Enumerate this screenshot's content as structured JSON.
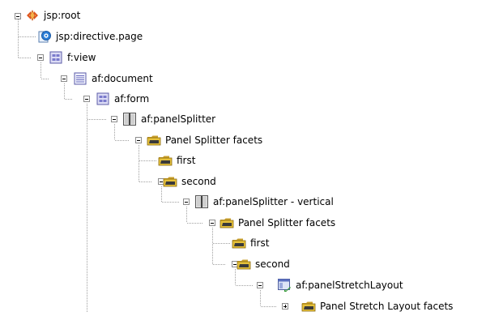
{
  "tree": {
    "nodes": [
      {
        "id": "jsp-root",
        "label": "jsp:root",
        "icon": "jsp-root-icon",
        "expanded": true
      },
      {
        "id": "jsp-directive-page",
        "label": "jsp:directive.page",
        "icon": "directive-icon"
      },
      {
        "id": "f-view",
        "label": "f:view",
        "icon": "view-icon",
        "expanded": true
      },
      {
        "id": "af-document",
        "label": "af:document",
        "icon": "document-icon",
        "expanded": true
      },
      {
        "id": "af-form",
        "label": "af:form",
        "icon": "form-icon",
        "expanded": true
      },
      {
        "id": "af-panelsplitter",
        "label": "af:panelSplitter",
        "icon": "panel-splitter-icon",
        "expanded": true
      },
      {
        "id": "panel-splitter-facets",
        "label": "Panel Splitter facets",
        "icon": "folder-icon",
        "expanded": true
      },
      {
        "id": "first",
        "label": "first",
        "icon": "folder-icon"
      },
      {
        "id": "second",
        "label": "second",
        "icon": "folder-icon",
        "expanded": true
      },
      {
        "id": "af-panelsplitter-vertical",
        "label": "af:panelSplitter - vertical",
        "icon": "panel-splitter-icon",
        "expanded": true
      },
      {
        "id": "panel-splitter-facets-2",
        "label": "Panel Splitter facets",
        "icon": "folder-icon",
        "expanded": true
      },
      {
        "id": "first-2",
        "label": "first",
        "icon": "folder-icon"
      },
      {
        "id": "second-2",
        "label": "second",
        "icon": "folder-icon",
        "expanded": true
      },
      {
        "id": "af-panelstretchlayout",
        "label": "af:panelStretchLayout",
        "icon": "panel-stretch-layout-icon",
        "expanded": true
      },
      {
        "id": "panel-stretch-layout-facets",
        "label": "Panel Stretch Layout facets",
        "icon": "folder-icon",
        "expanded": false
      }
    ]
  },
  "colors": {
    "line": "#a0a0a0",
    "jsp_icon": "#e0561c",
    "directive_icon": "#2c7fd8",
    "form_icon": "#7a7acc",
    "folder_icon": "#e6c13a",
    "folder_dark": "#3a3a3a"
  }
}
